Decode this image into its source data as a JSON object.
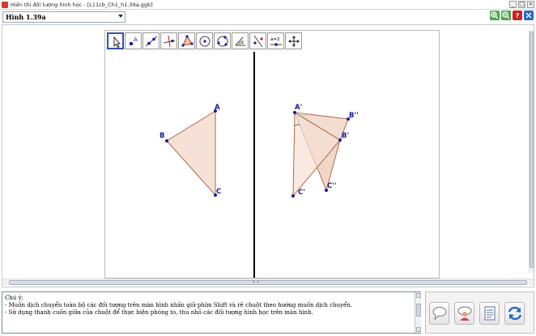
{
  "window": {
    "title": "Hiển thị đối tượng hình học - [L11cb_Ch1_h1.39a.ggb]",
    "controls": [
      "_",
      "□",
      "×"
    ]
  },
  "figure_selector": {
    "selected": "Hình 1.39a"
  },
  "toolbar_right": {
    "zoom_in_icon": "zoom-in-icon",
    "zoom_out_icon": "zoom-out-icon",
    "help_label": "?",
    "close_icon": "close-icon"
  },
  "tools": [
    "move-pointer-icon",
    "new-point-icon",
    "line-icon",
    "perpendicular-line-icon",
    "polygon-icon",
    "circle-icon",
    "circle-three-points-icon",
    "angle-icon",
    "reflect-icon",
    "slider-icon",
    "move-view-icon"
  ],
  "tool_texts": {
    "angle": "α",
    "slider": "a=2"
  },
  "geometry": {
    "points": {
      "A": "A",
      "B": "B",
      "C": "C",
      "A1": "A'",
      "B1": "B'",
      "C1": "C'",
      "B2": "B''",
      "C2": "C''"
    }
  },
  "notes": {
    "title": "Chú ý:",
    "lines": [
      "- Muốn dịch chuyển toàn bộ các đối tượng trên màn hình nhấn giữ phím Shift và rê chuột theo hướng muốn dịch chuyển.",
      "- Sử dụng thanh cuốn giữa của chuột để thực hiện phóng to, thu nhỏ các đối tượng hình học trên màn hình."
    ]
  },
  "actions": [
    "speech-bubble-icon",
    "presenter-icon",
    "document-icon",
    "refresh-icon"
  ],
  "colors": {
    "point": "#1a1aa0",
    "triangle_fill": "#f5e1d6",
    "triangle_stroke": "#b06a48",
    "accent_blue": "#2266cc"
  }
}
